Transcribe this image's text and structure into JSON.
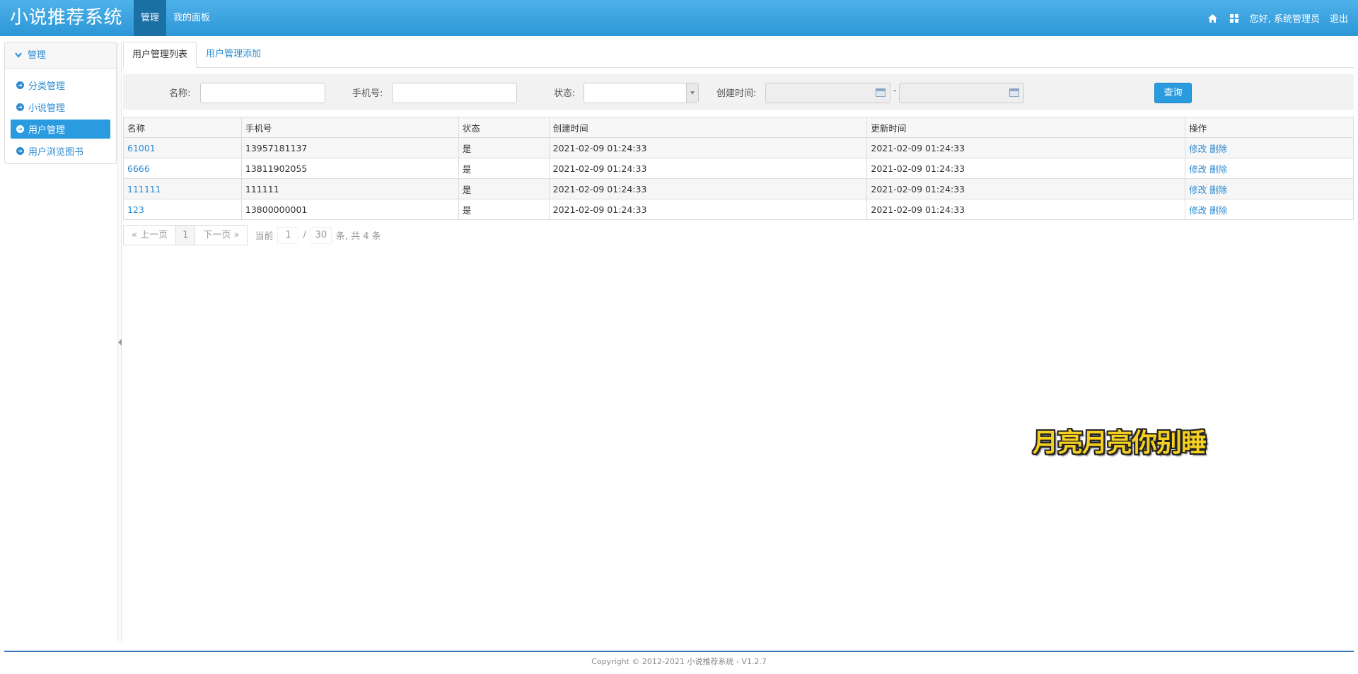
{
  "app": {
    "title": "小说推荐系统"
  },
  "topnav": [
    {
      "label": "管理"
    },
    {
      "label": "我的面板"
    }
  ],
  "topright": {
    "home_icon": "home-icon",
    "grid_icon": "grid-icon",
    "greeting": "您好, 系统管理员",
    "logout": "退出"
  },
  "sidebar": {
    "header": "管理",
    "items": [
      {
        "label": "分类管理"
      },
      {
        "label": "小说管理"
      },
      {
        "label": "用户管理"
      },
      {
        "label": "用户浏览图书"
      }
    ]
  },
  "tabs": [
    {
      "label": "用户管理列表"
    },
    {
      "label": "用户管理添加"
    }
  ],
  "filter": {
    "name_label": "名称:",
    "name_value": "",
    "phone_label": "手机号:",
    "phone_value": "",
    "status_label": "状态:",
    "status_value": "",
    "created_label": "创建时间:",
    "created_from": "",
    "created_to": "",
    "range_sep": "-",
    "query_button": "查询"
  },
  "table": {
    "columns": [
      "名称",
      "手机号",
      "状态",
      "创建时间",
      "更新时间",
      "操作"
    ],
    "rows": [
      {
        "name": "61001",
        "phone": "13957181137",
        "status": "是",
        "created": "2021-02-09 01:24:33",
        "updated": "2021-02-09 01:24:33"
      },
      {
        "name": "6666",
        "phone": "13811902055",
        "status": "是",
        "created": "2021-02-09 01:24:33",
        "updated": "2021-02-09 01:24:33"
      },
      {
        "name": "111111",
        "phone": "111111",
        "status": "是",
        "created": "2021-02-09 01:24:33",
        "updated": "2021-02-09 01:24:33"
      },
      {
        "name": "123",
        "phone": "13800000001",
        "status": "是",
        "created": "2021-02-09 01:24:33",
        "updated": "2021-02-09 01:24:33"
      }
    ],
    "action_edit": "修改",
    "action_delete": "删除"
  },
  "pager": {
    "prev": "« 上一页",
    "page": "1",
    "next": "下一页 »",
    "current_label": "当前",
    "current_value": "1",
    "slash": "/",
    "page_size": "30",
    "summary": "条, 共 4 条"
  },
  "watermark": "月亮月亮你别睡",
  "footer": "Copyright © 2012-2021 小说推荐系统 - V1.2.7",
  "colors": {
    "header": "#2c96d6",
    "accent": "#2b8bd1",
    "active_nav": "#1a6fa5"
  }
}
